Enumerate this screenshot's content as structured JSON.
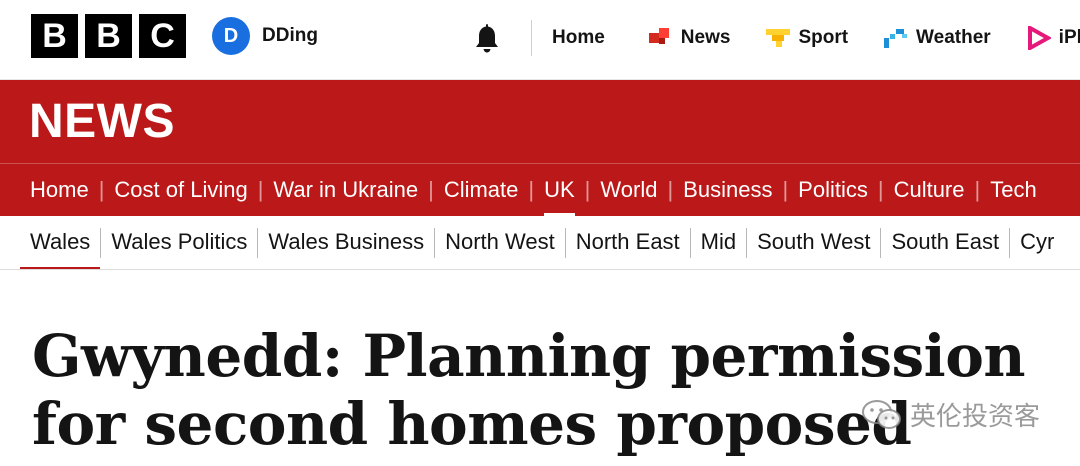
{
  "header": {
    "logo_letters": [
      "B",
      "B",
      "C"
    ],
    "account": {
      "initial": "D",
      "name": "DDing",
      "avatar_color": "#1a6fe0"
    },
    "nav": [
      {
        "label": "Home",
        "icon": "none"
      },
      {
        "label": "News",
        "icon": "news-icon",
        "color": "#d42a1f"
      },
      {
        "label": "Sport",
        "icon": "sport-icon",
        "color": "#ffd230"
      },
      {
        "label": "Weather",
        "icon": "weather-icon",
        "color": "#1d8fd6"
      },
      {
        "label": "iPlay",
        "icon": "iplayer-icon",
        "color": "#e5197c"
      }
    ]
  },
  "news": {
    "wordmark": "NEWS",
    "band_color": "#bb1919",
    "primary_nav": [
      {
        "label": "Home"
      },
      {
        "label": "Cost of Living"
      },
      {
        "label": "War in Ukraine"
      },
      {
        "label": "Climate"
      },
      {
        "label": "UK",
        "active": true
      },
      {
        "label": "World"
      },
      {
        "label": "Business"
      },
      {
        "label": "Politics"
      },
      {
        "label": "Culture"
      },
      {
        "label": "Tech"
      }
    ],
    "secondary_nav": [
      {
        "label": "Wales",
        "active": true
      },
      {
        "label": "Wales Politics"
      },
      {
        "label": "Wales Business"
      },
      {
        "label": "North West"
      },
      {
        "label": "North East"
      },
      {
        "label": "Mid"
      },
      {
        "label": "South West"
      },
      {
        "label": "South East"
      },
      {
        "label": "Cyr"
      }
    ]
  },
  "article": {
    "headline": "Gwynedd: Planning permission for second homes proposed"
  },
  "watermark": {
    "text": "英伦投资客",
    "icon": "wechat-icon"
  }
}
